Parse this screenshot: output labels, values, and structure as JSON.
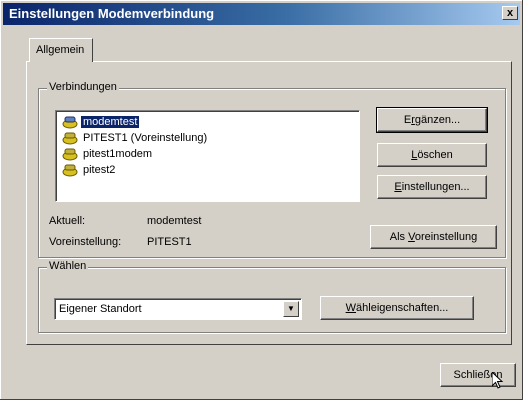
{
  "window": {
    "title": "Einstellungen Modemverbindung",
    "close_glyph": "x"
  },
  "tabs": [
    {
      "label": "Allgemein"
    }
  ],
  "connections_group": {
    "label": "Verbindungen",
    "items": [
      {
        "label": "modemtest",
        "icon": "phone-modem-icon",
        "selected": true
      },
      {
        "label": "PITEST1 (Voreinstellung)",
        "icon": "phone-modem-icon",
        "selected": false
      },
      {
        "label": "pitest1modem",
        "icon": "phone-modem-icon",
        "selected": false
      },
      {
        "label": "pitest2",
        "icon": "phone-modem-icon",
        "selected": false
      }
    ],
    "buttons": {
      "add": {
        "prefix": "E",
        "mnemonic": "r",
        "suffix": "gänzen..."
      },
      "delete": {
        "prefix": "",
        "mnemonic": "L",
        "suffix": "öschen"
      },
      "settings": {
        "prefix": "",
        "mnemonic": "E",
        "suffix": "instellungen..."
      },
      "set_default": {
        "prefix": "Als ",
        "mnemonic": "V",
        "suffix": "oreinstellung"
      }
    },
    "current_label": "Aktuell:",
    "current_value": "modemtest",
    "default_label": "Voreinstellung:",
    "default_value": "PITEST1"
  },
  "dial_group": {
    "label": "Wählen",
    "location_value": "Eigener Standort",
    "properties_button": {
      "prefix": "",
      "mnemonic": "W",
      "suffix": "ähleigenschaften..."
    }
  },
  "footer": {
    "close_label": "Schließen"
  },
  "colors": {
    "title_start": "#0a246a",
    "title_end": "#a6caf0",
    "face": "#d4d0c8",
    "selection": "#0a246a"
  }
}
